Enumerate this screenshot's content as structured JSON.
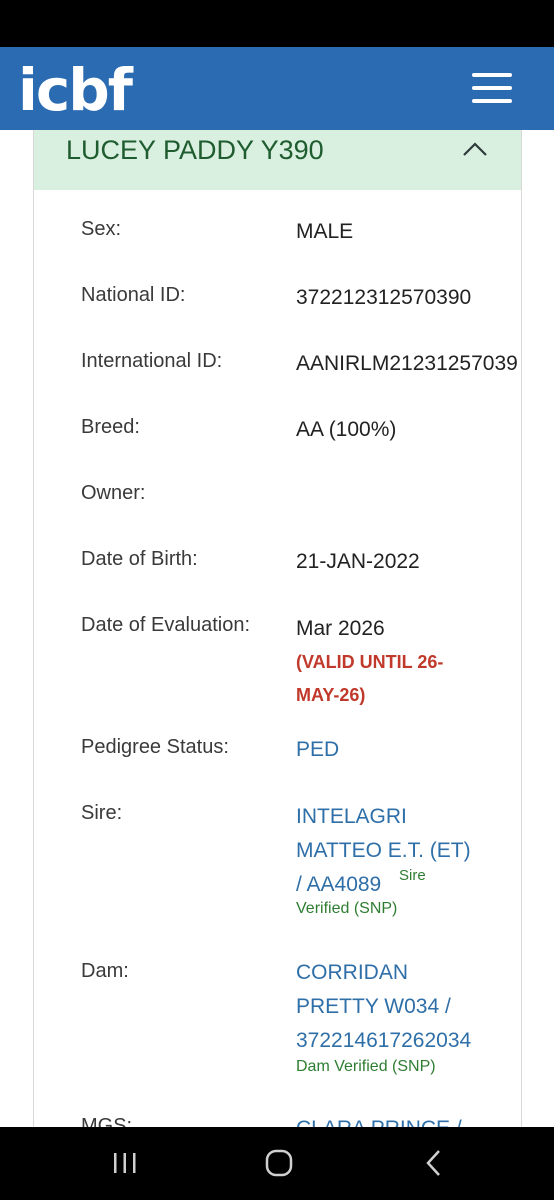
{
  "header": {
    "logo_text": "icbf",
    "menu_icon": "hamburger-menu-icon"
  },
  "card": {
    "title": "LUCEY PADDY Y390",
    "collapse_icon": "chevron-up-icon",
    "fields": {
      "sex": {
        "label": "Sex:",
        "value": "MALE"
      },
      "national_id": {
        "label": "National ID:",
        "value": "372212312570390"
      },
      "international_id": {
        "label": "International ID:",
        "value": "AANIRLM21231257039"
      },
      "breed": {
        "label": "Breed:",
        "value": "AA (100%)"
      },
      "owner": {
        "label": "Owner:",
        "value": ""
      },
      "dob": {
        "label": "Date of Birth:",
        "value": "21-JAN-2022"
      },
      "evaluation": {
        "label": "Date of Evaluation:",
        "value": "Mar 2026",
        "validity_line1": "(VALID UNTIL 26-",
        "validity_line2": "MAY-26)"
      },
      "pedigree": {
        "label": "Pedigree Status:",
        "value": "PED"
      },
      "sire": {
        "label": "Sire:",
        "line1": "INTELAGRI",
        "line2": "MATTEO E.T. (ET)",
        "line3": "/ AA4089",
        "verified_sup": "Sire",
        "verified_text": "Verified (SNP)"
      },
      "dam": {
        "label": "Dam:",
        "line1": "CORRIDAN",
        "line2": "PRETTY W034 /",
        "line3": "372214617262034",
        "verified_text": "Dam Verified (SNP)"
      },
      "mgs": {
        "label": "MGS:",
        "value": "CLARA PRINCE /"
      }
    }
  },
  "navigation": {
    "recent_icon": "recent-apps-icon",
    "home_icon": "home-icon",
    "back_icon": "back-icon"
  },
  "colors": {
    "header_bg": "#2a6bb2",
    "card_header_bg": "#d9efdf",
    "title_green": "#1f5c2f",
    "link_blue": "#2f6fa8",
    "warning_red": "#c0392b"
  }
}
